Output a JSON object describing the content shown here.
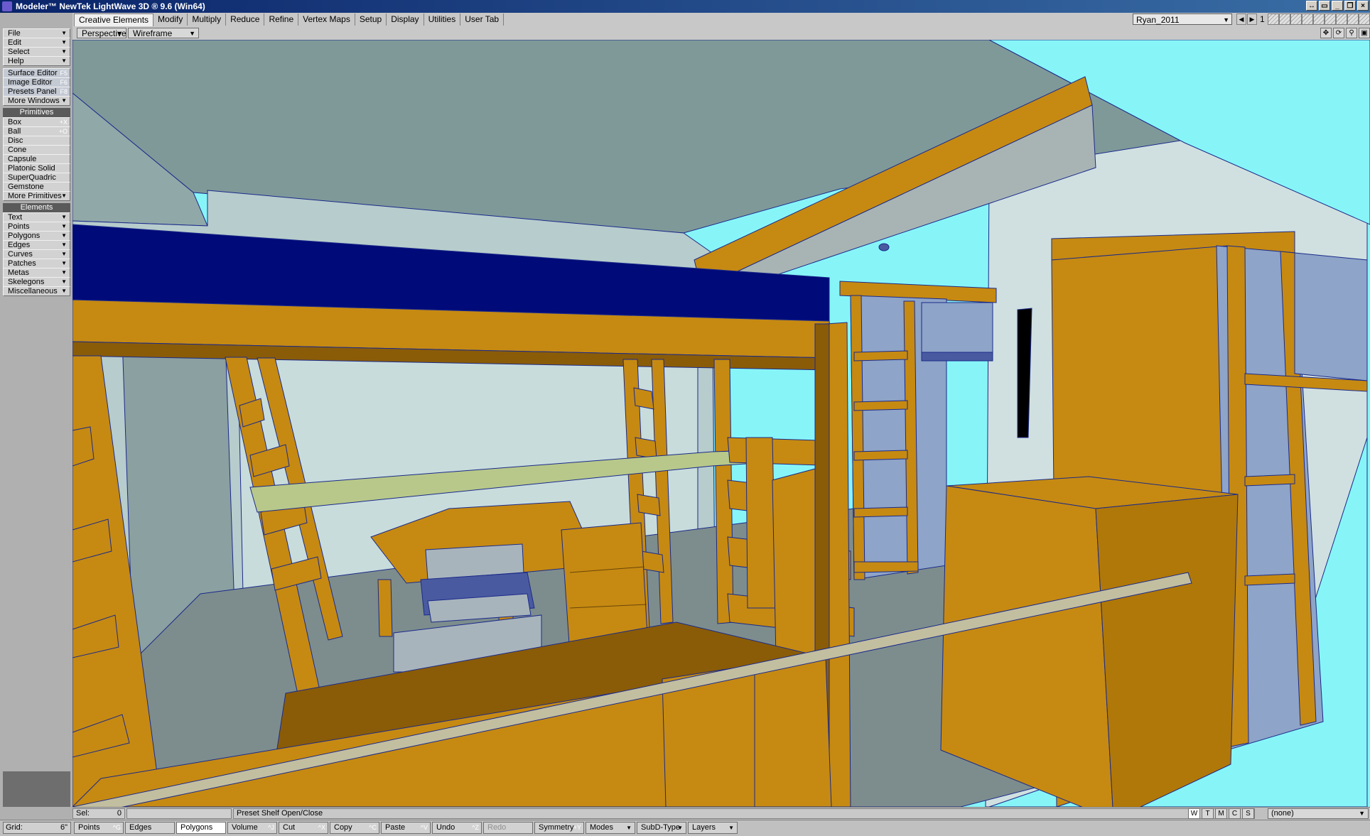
{
  "title": "Modeler™ NewTek LightWave 3D ® 9.6  (Win64)",
  "tabs": [
    "Creative Elements",
    "Modify",
    "Multiply",
    "Reduce",
    "Refine",
    "Vertex Maps",
    "Setup",
    "Display",
    "Utilities",
    "User Tab"
  ],
  "active_tab": "Creative Elements",
  "layer": {
    "name": "Ryan_2011",
    "number": "1"
  },
  "sidebar": {
    "menus": [
      "File",
      "Edit",
      "Select",
      "Help"
    ],
    "windows": [
      {
        "label": "Surface Editor",
        "shortcut": "F5"
      },
      {
        "label": "Image Editor",
        "shortcut": "F6"
      },
      {
        "label": "Presets Panel",
        "shortcut": "F8"
      }
    ],
    "more_windows": "More Windows",
    "primitives_header": "Primitives",
    "primitives": [
      {
        "label": "Box",
        "shortcut": "+X"
      },
      {
        "label": "Ball",
        "shortcut": "+O"
      },
      {
        "label": "Disc",
        "shortcut": ""
      },
      {
        "label": "Cone",
        "shortcut": ""
      },
      {
        "label": "Capsule",
        "shortcut": ""
      },
      {
        "label": "Platonic Solid",
        "shortcut": ""
      },
      {
        "label": "SuperQuadric",
        "shortcut": ""
      },
      {
        "label": "Gemstone",
        "shortcut": ""
      }
    ],
    "more_primitives": "More Primitives",
    "elements_header": "Elements",
    "elements": [
      "Text",
      "Points",
      "Polygons",
      "Edges",
      "Curves",
      "Patches",
      "Metas",
      "Skelegons",
      "Miscellaneous"
    ]
  },
  "viewport": {
    "view": "Perspective",
    "shading": "Wireframe Shade"
  },
  "status": {
    "sel_label": "Sel:",
    "sel_value": "0",
    "message": "Preset Shelf Open/Close",
    "modes": [
      "W",
      "T",
      "M",
      "C",
      "S"
    ],
    "active_mode": "W",
    "dropdown": "(none)"
  },
  "bottom": {
    "grid_label": "Grid:",
    "grid_value": "6\"",
    "buttons": [
      {
        "label": "Points",
        "shortcut": "^G",
        "state": "normal"
      },
      {
        "label": "Edges",
        "shortcut": "",
        "state": "normal"
      },
      {
        "label": "Polygons",
        "shortcut": "^H",
        "state": "active"
      },
      {
        "label": "Volume",
        "shortcut": "^J",
        "state": "normal"
      },
      {
        "label": "Cut",
        "shortcut": "^X",
        "state": "normal"
      },
      {
        "label": "Copy",
        "shortcut": "^C",
        "state": "normal"
      },
      {
        "label": "Paste",
        "shortcut": "^V",
        "state": "normal"
      },
      {
        "label": "Undo",
        "shortcut": "^Z",
        "state": "normal"
      },
      {
        "label": "Redo",
        "shortcut": "",
        "state": "disabled"
      },
      {
        "label": "Symmetry",
        "shortcut": "+Y",
        "state": "normal"
      },
      {
        "label": "Modes",
        "shortcut": "",
        "state": "dropdown"
      },
      {
        "label": "SubD-Type",
        "shortcut": "",
        "state": "dropdown"
      },
      {
        "label": "Layers",
        "shortcut": "",
        "state": "dropdown"
      }
    ]
  },
  "colors": {
    "wood": "#c68a12",
    "wood_dark": "#8a5c08",
    "blue": "#000a78",
    "wall": "#c8d8d8",
    "floor": "#7d8d8d",
    "sky": "#87f5f8"
  }
}
